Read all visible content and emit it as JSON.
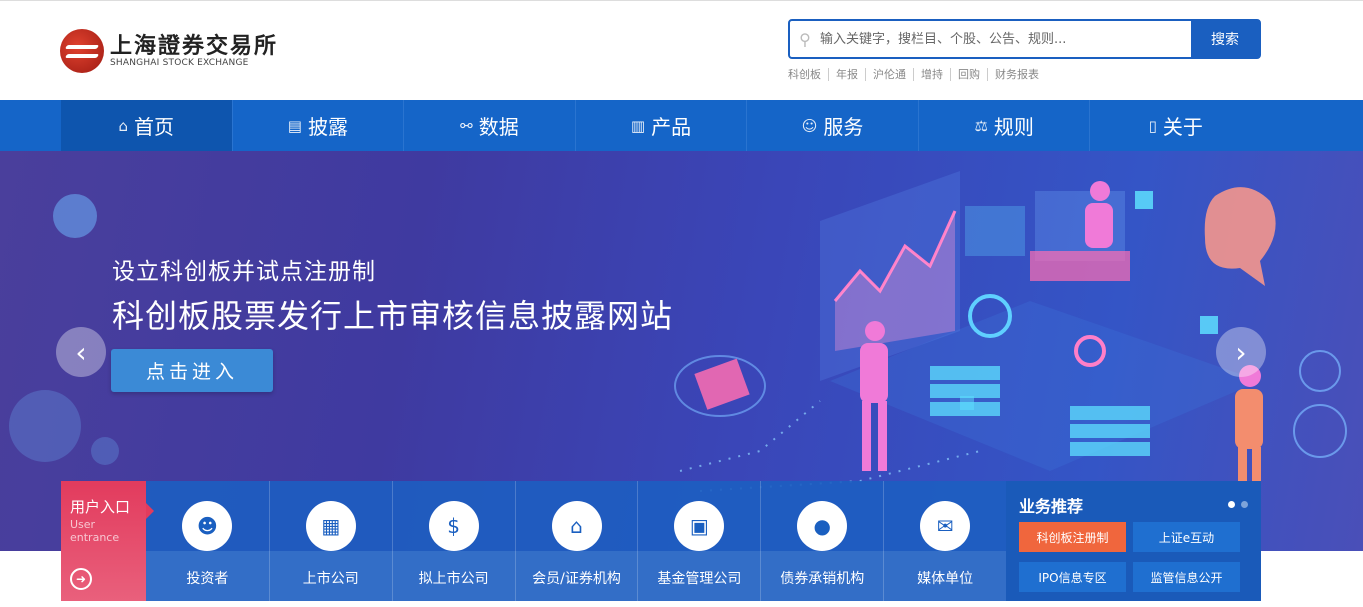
{
  "logo": {
    "cn": "上海證券交易所",
    "en": "SHANGHAI STOCK EXCHANGE"
  },
  "search": {
    "placeholder": "输入关键字，搜栏目、个股、公告、规则...",
    "button": "搜索"
  },
  "hot_links": [
    "科创板",
    "年报",
    "沪伦通",
    "增持",
    "回购",
    "财务报表"
  ],
  "nav": [
    {
      "label": "首页",
      "icon": "home-icon",
      "glyph": "⌂"
    },
    {
      "label": "披露",
      "icon": "document-icon",
      "glyph": "▤"
    },
    {
      "label": "数据",
      "icon": "data-icon",
      "glyph": "⚯"
    },
    {
      "label": "产品",
      "icon": "chart-icon",
      "glyph": "▥"
    },
    {
      "label": "服务",
      "icon": "service-icon",
      "glyph": "☺"
    },
    {
      "label": "规则",
      "icon": "scale-icon",
      "glyph": "⚖"
    },
    {
      "label": "关于",
      "icon": "book-icon",
      "glyph": "▯"
    }
  ],
  "banner": {
    "subtitle": "设立科创板并试点注册制",
    "title": "科创板股票发行上市审核信息披露网站",
    "button": "点击进入"
  },
  "user_entry": {
    "title": "用户入口",
    "en_line1": "User",
    "en_line2": "entrance"
  },
  "entries": [
    {
      "label": "投资者",
      "icon": "investor-icon",
      "glyph": "☻"
    },
    {
      "label": "上市公司",
      "icon": "listed-company-icon",
      "glyph": "▦"
    },
    {
      "label": "拟上市公司",
      "icon": "ipo-company-icon",
      "glyph": "$"
    },
    {
      "label": "会员/证券机构",
      "icon": "institution-icon",
      "glyph": "⌂"
    },
    {
      "label": "基金管理公司",
      "icon": "fund-icon",
      "glyph": "▣"
    },
    {
      "label": "债券承销机构",
      "icon": "bond-underwriter-icon",
      "glyph": "●"
    },
    {
      "label": "媒体单位",
      "icon": "media-icon",
      "glyph": "✉"
    }
  ],
  "business": {
    "title": "业务推荐",
    "items": [
      "科创板注册制",
      "上证e互动",
      "IPO信息专区",
      "监管信息公开"
    ]
  },
  "colors": {
    "primary": "#1565c8",
    "accent": "#f0663d",
    "user_entry": "#e23b5d"
  }
}
